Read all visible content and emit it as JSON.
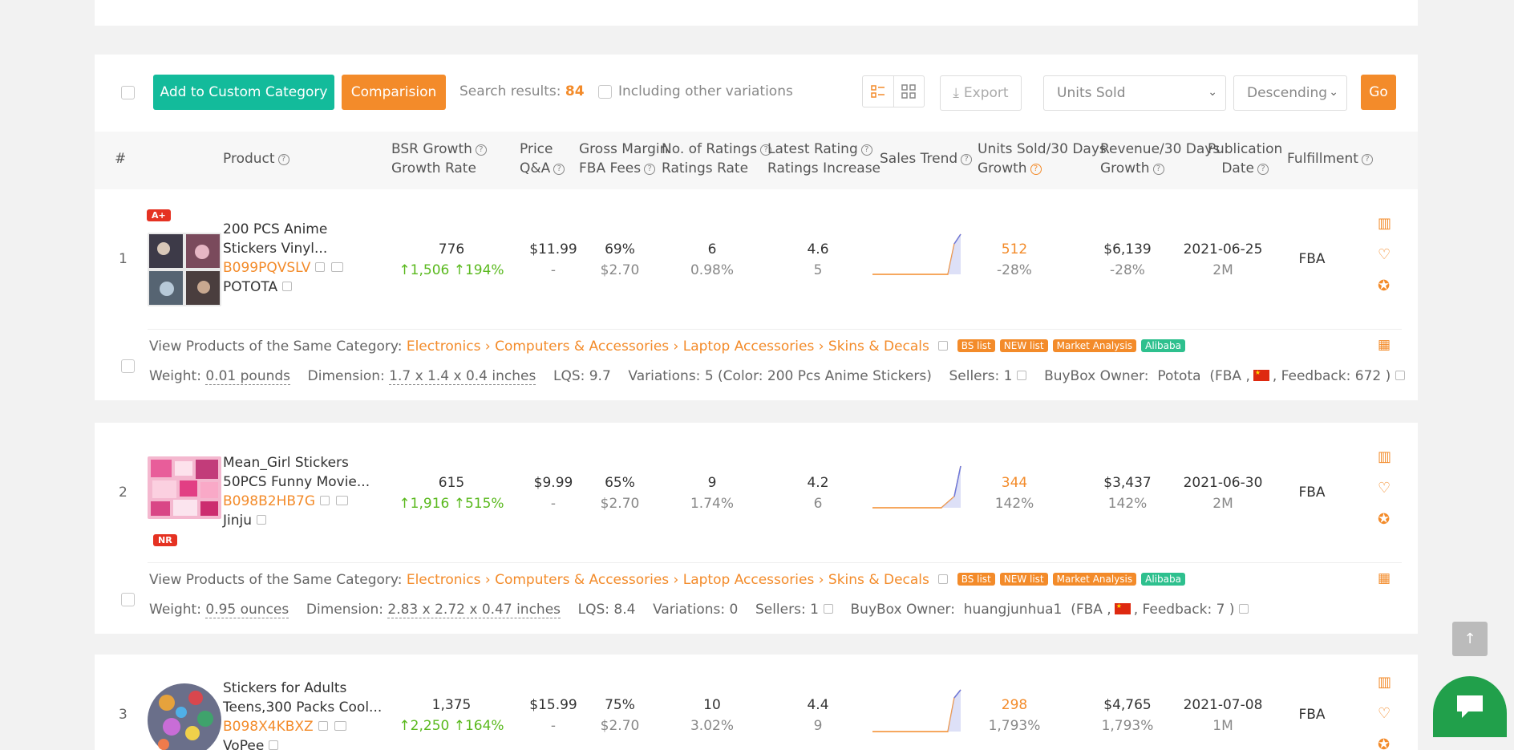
{
  "toolbar": {
    "add_label": "Add to Custom Category",
    "compare_label": "Comparision",
    "search_results_label": "Search results:",
    "search_results_count": "84",
    "include_variations_label": "Including other variations",
    "export_label": "Export",
    "sort_field": "Units Sold",
    "sort_order": "Descending",
    "go_label": "Go"
  },
  "header": {
    "index": "#",
    "product": "Product",
    "bsr_growth": "BSR Growth",
    "growth_rate": "Growth Rate",
    "price": "Price",
    "qa": "Q&A",
    "gross_margin": "Gross Margin",
    "fba_fees": "FBA Fees",
    "no_ratings": "No. of Ratings",
    "ratings_rate": "Ratings Rate",
    "latest_rating": "Latest Rating",
    "ratings_increase": "Ratings Increase",
    "sales_trend": "Sales Trend",
    "units_sold": "Units Sold/30 Days",
    "units_growth": "Growth",
    "revenue": "Revenue/30 Days",
    "revenue_growth": "Growth",
    "publication": "Publication",
    "publication_date": "Date",
    "fulfillment": "Fulfillment"
  },
  "rows": [
    {
      "index": "1",
      "badge": "A+",
      "title_line1": "200 PCS Anime",
      "title_line2": "Stickers Vinyl...",
      "asin": "B099PQVSLV",
      "brand": "POTOTA",
      "bsr": "776",
      "bsr_growth": "1,506",
      "bsr_rate": "194%",
      "price": "$11.99",
      "qa": "-",
      "margin": "69%",
      "fba": "$2.70",
      "ratings": "6",
      "ratings_rate": "0.98%",
      "rating": "4.6",
      "rating_inc": "5",
      "units": "512",
      "units_growth": "-28%",
      "revenue": "$6,139",
      "revenue_growth": "-28%",
      "date": "2021-06-25",
      "age": "2M",
      "fulfillment": "FBA",
      "category_label": "View Products of the Same Category:",
      "category_path": "Electronics › Computers & Accessories › Laptop Accessories › Skins & Decals",
      "tags": [
        "BS list",
        "NEW list",
        "Market Analysis",
        "Alibaba"
      ],
      "weight_label": "Weight:",
      "weight": "0.01 pounds",
      "dimension_label": "Dimension:",
      "dimension": "1.7 x 1.4 x 0.4 inches",
      "lqs": "LQS: 9.7",
      "variations": "Variations: 5 (Color: 200 Pcs Anime Stickers)",
      "sellers": "Sellers: 1",
      "buybox_label": "BuyBox Owner:",
      "buybox_owner": "Potota",
      "buybox_fba": "(FBA ,",
      "feedback": ", Feedback: 672 )"
    },
    {
      "index": "2",
      "badge": "NR",
      "title_line1": "Mean_Girl Stickers",
      "title_line2": "50PCS Funny Movie...",
      "asin": "B098B2HB7G",
      "brand": "Jinju",
      "bsr": "615",
      "bsr_growth": "1,916",
      "bsr_rate": "515%",
      "price": "$9.99",
      "qa": "-",
      "margin": "65%",
      "fba": "$2.70",
      "ratings": "9",
      "ratings_rate": "1.74%",
      "rating": "4.2",
      "rating_inc": "6",
      "units": "344",
      "units_growth": "142%",
      "revenue": "$3,437",
      "revenue_growth": "142%",
      "date": "2021-06-30",
      "age": "2M",
      "fulfillment": "FBA",
      "category_label": "View Products of the Same Category:",
      "category_path": "Electronics › Computers & Accessories › Laptop Accessories › Skins & Decals",
      "tags": [
        "BS list",
        "NEW list",
        "Market Analysis",
        "Alibaba"
      ],
      "weight_label": "Weight:",
      "weight": "0.95 ounces",
      "dimension_label": "Dimension:",
      "dimension": "2.83 x 2.72 x 0.47 inches",
      "lqs": "LQS: 8.4",
      "variations": "Variations: 0",
      "sellers": "Sellers: 1",
      "buybox_label": "BuyBox Owner:",
      "buybox_owner": "huangjunhua1",
      "buybox_fba": "(FBA ,",
      "feedback": ", Feedback: 7 )"
    },
    {
      "index": "3",
      "title_line1": "Stickers for Adults",
      "title_line2": "Teens,300 Packs Cool...",
      "asin": "B098X4KBXZ",
      "brand": "VoPee",
      "bsr": "1,375",
      "bsr_growth": "2,250",
      "bsr_rate": "164%",
      "price": "$15.99",
      "qa": "-",
      "margin": "75%",
      "fba": "$2.70",
      "ratings": "10",
      "ratings_rate": "3.02%",
      "rating": "4.4",
      "rating_inc": "9",
      "units": "298",
      "units_growth": "1,793%",
      "revenue": "$4,765",
      "revenue_growth": "1,793%",
      "date": "2021-07-08",
      "age": "1M",
      "fulfillment": "FBA"
    }
  ],
  "colors": {
    "accent": "#f38b2a",
    "teal": "#13bb9b",
    "green": "#5ab91e",
    "badge_red": "#e53222"
  }
}
